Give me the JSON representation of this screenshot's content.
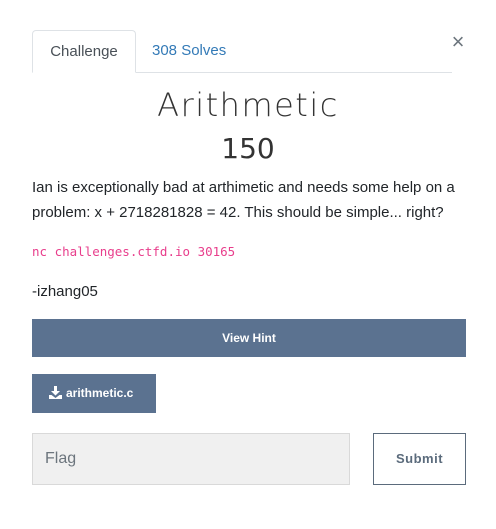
{
  "tabs": {
    "challenge_label": "Challenge",
    "solves_label": "308 Solves"
  },
  "close_glyph": "×",
  "challenge": {
    "name": "Arithmetic",
    "points": "150",
    "description": "Ian is exceptionally bad at arthimetic and needs some help on a problem: x + 2718281828 = 42. This should be simple... right?",
    "connection": "nc challenges.ctfd.io 30165",
    "author": "-izhang05"
  },
  "buttons": {
    "hint_label": "View Hint",
    "file_label": "arithmetic.c",
    "submit_label": "Submit"
  },
  "flag_input": {
    "placeholder": "Flag",
    "value": ""
  },
  "icons": {
    "close": "close-icon",
    "download": "download-icon"
  },
  "colors": {
    "button_bg": "#5b7290",
    "link": "#337ab7",
    "code": "#e83e8c"
  }
}
